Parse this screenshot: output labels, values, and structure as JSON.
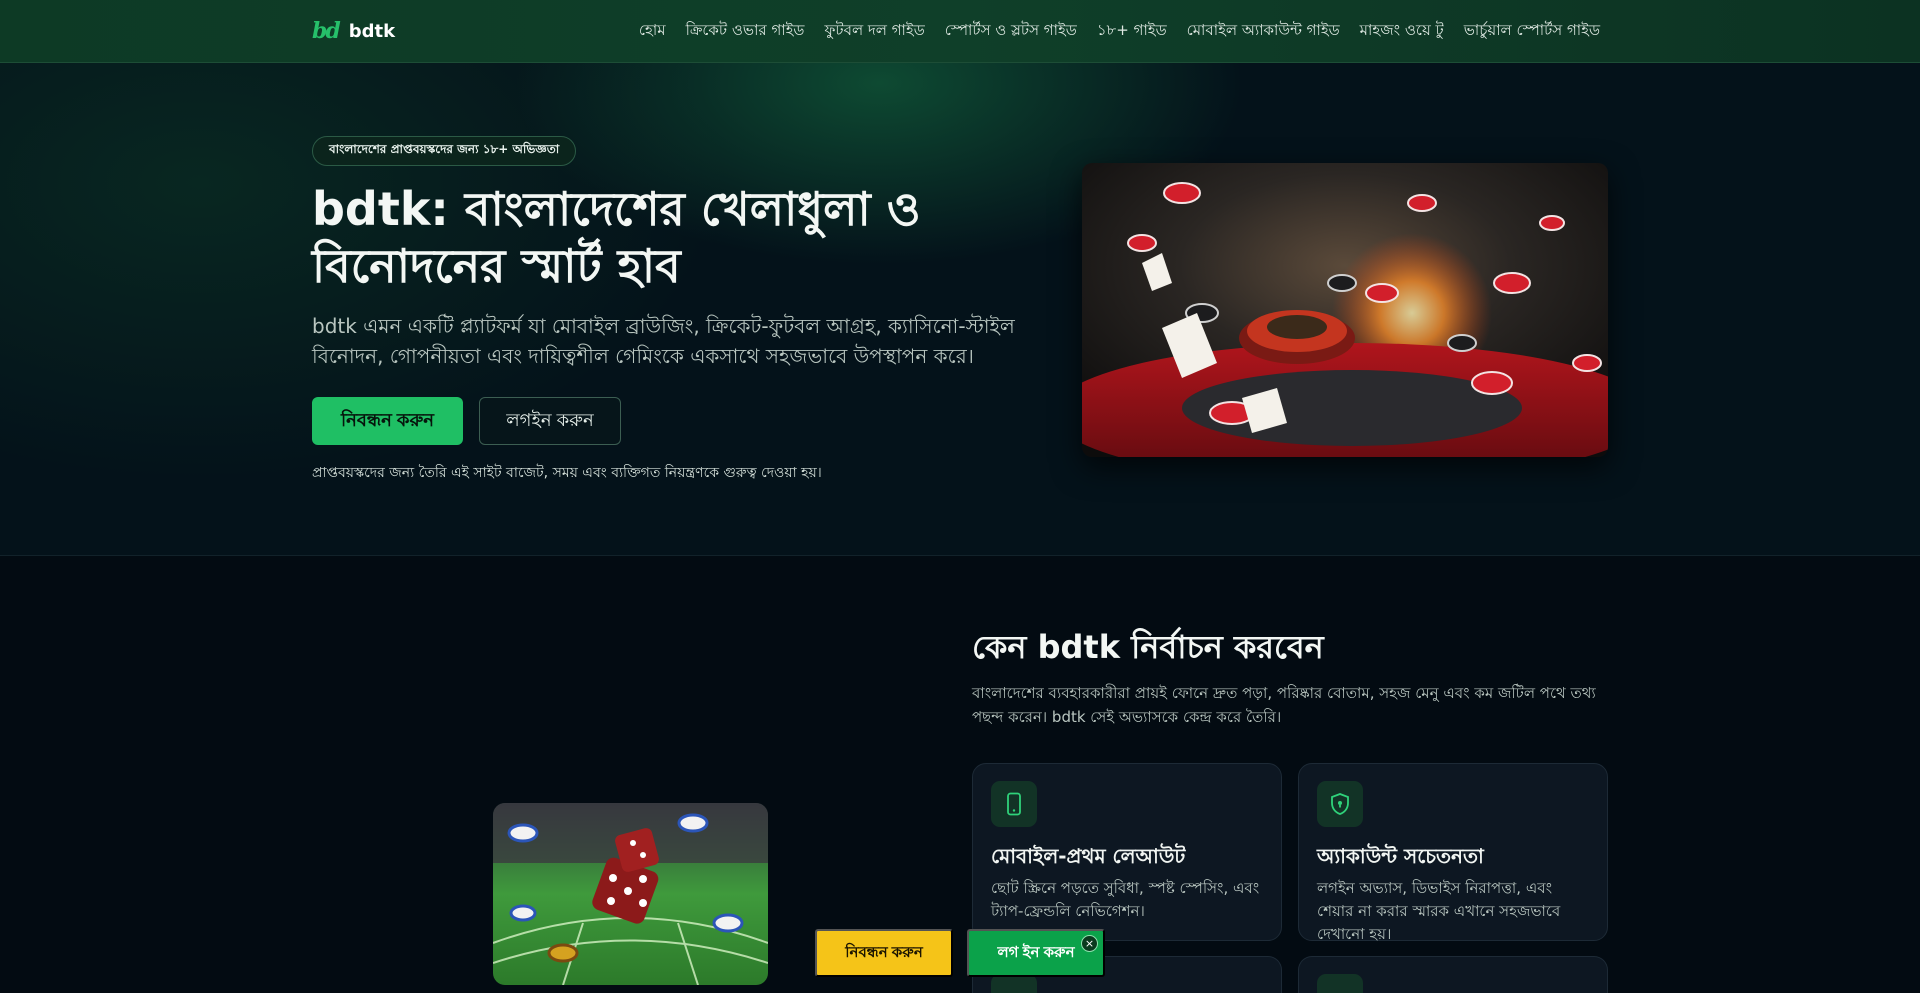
{
  "header": {
    "logo_mark": "bd",
    "logo_text": "bdtk",
    "nav": [
      {
        "label": "হোম"
      },
      {
        "label": "ক্রিকেট ওভার গাইড"
      },
      {
        "label": "ফুটবল দল গাইড"
      },
      {
        "label": "স্পোর্টস ও স্লটস গাইড"
      },
      {
        "label": "১৮+ গাইড"
      },
      {
        "label": "মোবাইল অ্যাকাউন্ট গাইড"
      },
      {
        "label": "মাহজং ওয়ে টু"
      },
      {
        "label": "ভার্চুয়াল স্পোর্টস গাইড"
      }
    ]
  },
  "hero": {
    "badge": "বাংলাদেশের প্রাপ্তবয়স্কদের জন্য ১৮+ অভিজ্ঞতা",
    "title": "bdtk: বাংলাদেশের খেলাধুলা ও বিনোদনের স্মার্ট হাব",
    "description": "bdtk এমন একটি প্ল্যাটফর্ম যা মোবাইল ব্রাউজিং, ক্রিকেট-ফুটবল আগ্রহ, ক্যাসিনো-স্টাইল বিনোদন, গোপনীয়তা এবং দায়িত্বশীল গেমিংকে একসাথে সহজভাবে উপস্থাপন করে।",
    "register_label": "নিবন্ধন করুন",
    "login_label": "লগইন করুন",
    "note": "প্রাপ্তবয়স্কদের জন্য তৈরি এই সাইট বাজেট, সময় এবং ব্যক্তিগত নিয়ন্ত্রণকে গুরুত্ব দেওয়া হয়।"
  },
  "why": {
    "title": "কেন bdtk নির্বাচন করবেন",
    "description": "বাংলাদেশের ব্যবহারকারীরা প্রায়ই ফোনে দ্রুত পড়া, পরিষ্কার বোতাম, সহজ মেনু এবং কম জটিল পথে তথ্য পছন্দ করেন। bdtk সেই অভ্যাসকে কেন্দ্র করে তৈরি।",
    "cards": [
      {
        "icon": "mobile-icon",
        "title": "মোবাইল-প্রথম লেআউট",
        "text": "ছোট স্ক্রিনে পড়তে সুবিধা, স্পষ্ট স্পেসিং, এবং ট্যাপ-ফ্রেন্ডলি নেভিগেশন।"
      },
      {
        "icon": "shield-icon",
        "title": "অ্যাকাউন্ট সচেতনতা",
        "text": "লগইন অভ্যাস, ডিভাইস নিরাপত্তা, এবং শেয়ার না করার স্মারক এখানে সহজভাবে দেখানো হয়।"
      }
    ]
  },
  "sticky": {
    "register_label": "নিবন্ধন করুন",
    "login_label": "লগ ইন করুন",
    "close_glyph": "×"
  },
  "colors": {
    "accent": "#1fbf64",
    "header_bg": "#0f3f29",
    "page_bg": "#030b12",
    "cta_yellow": "#f5c418",
    "cta_green": "#0ba24a"
  }
}
